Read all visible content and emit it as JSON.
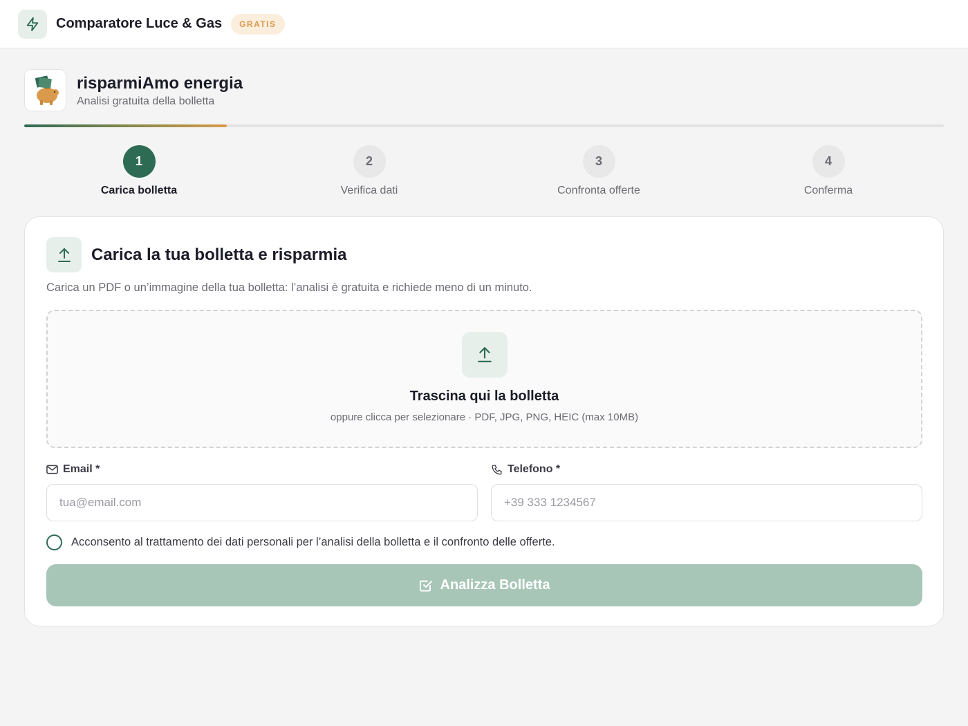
{
  "topbar": {
    "title": "Comparatore Luce & Gas",
    "badge": "GRATIS",
    "icon": "lightning-icon"
  },
  "brand": {
    "name": "risparmiAmo energia",
    "subtitle": "Analisi gratuita della bolletta",
    "logo": "piggy-bank-logo"
  },
  "progress": {
    "percent": 22
  },
  "steps": [
    {
      "number": "1",
      "label": "Carica bolletta",
      "active": true
    },
    {
      "number": "2",
      "label": "Verifica dati",
      "active": false
    },
    {
      "number": "3",
      "label": "Confronta offerte",
      "active": false
    },
    {
      "number": "4",
      "label": "Conferma",
      "active": false
    }
  ],
  "card": {
    "title": "Carica la tua bolletta e risparmia",
    "description": "Carica un PDF o un’immagine della tua bolletta: l’analisi è gratuita e richiede meno di un minuto.",
    "icon": "upload-icon"
  },
  "dropzone": {
    "title": "Trascina qui la bolletta",
    "subtitle": "oppure clicca per selezionare · PDF, JPG, PNG, HEIC (max 10MB)",
    "icon": "upload-icon"
  },
  "form": {
    "email_label": "Email *",
    "email_placeholder": "tua@email.com",
    "email_value": "",
    "phone_label": "Telefono *",
    "phone_placeholder": "+39 333 1234567",
    "phone_value": "",
    "consent": "Acconsento al trattamento dei dati personali per l’analisi della bolletta e il confronto delle offerte.",
    "consent_checked": false,
    "submit_label": "Analizza Bolletta"
  },
  "colors": {
    "primary": "#2e6b55",
    "accent": "#d99a4c",
    "button_disabled": "#a8c6b8",
    "background": "#f4f4f4"
  }
}
